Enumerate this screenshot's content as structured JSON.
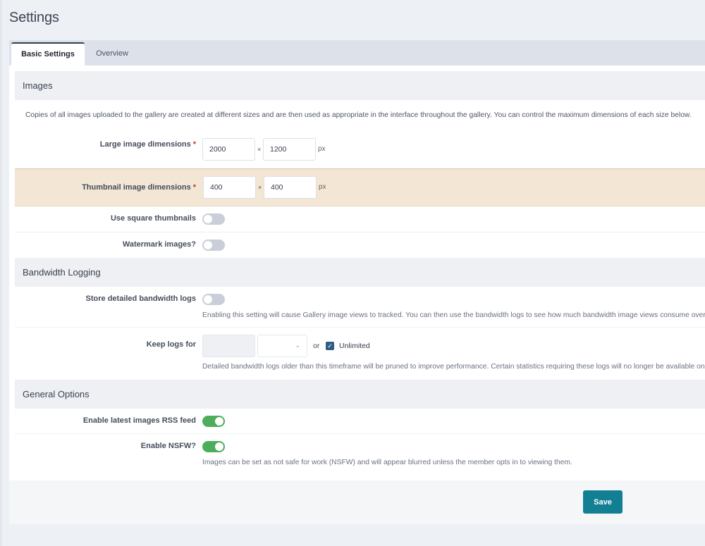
{
  "page": {
    "title": "Settings"
  },
  "tabs": [
    {
      "label": "Basic Settings",
      "active": true
    },
    {
      "label": "Overview",
      "active": false
    }
  ],
  "sections": {
    "images": {
      "title": "Images",
      "intro": "Copies of all images uploaded to the gallery are created at different sizes and are then used as appropriate in the interface throughout the gallery. You can control the maximum dimensions of each size below.",
      "large": {
        "label": "Large image dimensions",
        "required": "*",
        "width": "2000",
        "height": "1200",
        "times": "×",
        "unit": "px"
      },
      "thumb": {
        "label": "Thumbnail image dimensions",
        "required": "*",
        "width": "400",
        "height": "400",
        "times": "×",
        "unit": "px"
      },
      "square": {
        "label": "Use square thumbnails",
        "enabled": false
      },
      "watermark": {
        "label": "Watermark images?",
        "enabled": false
      }
    },
    "bandwidth": {
      "title": "Bandwidth Logging",
      "store": {
        "label": "Store detailed bandwidth logs",
        "enabled": false,
        "desc": "Enabling this setting will cause Gallery image views to tracked. You can then use the bandwidth logs to see how much bandwidth image views consume over p"
      },
      "keep": {
        "label": "Keep logs for",
        "value": "",
        "unit_select": "",
        "or": "or",
        "unlimited_label": "Unlimited",
        "unlimited_checked": true,
        "desc": "Detailed bandwidth logs older than this timeframe will be pruned to improve performance. Certain statistics requiring these logs will no longer be available onc"
      }
    },
    "general": {
      "title": "General Options",
      "rss": {
        "label": "Enable latest images RSS feed",
        "enabled": true
      },
      "nsfw": {
        "label": "Enable NSFW?",
        "enabled": true,
        "desc": "Images can be set as not safe for work (NSFW) and will appear blurred unless the member opts in to viewing them."
      }
    }
  },
  "footer": {
    "save_label": "Save"
  },
  "colors": {
    "accent": "#137f93",
    "toggle_on": "#4cae5b",
    "highlight": "#f3e6d5"
  }
}
